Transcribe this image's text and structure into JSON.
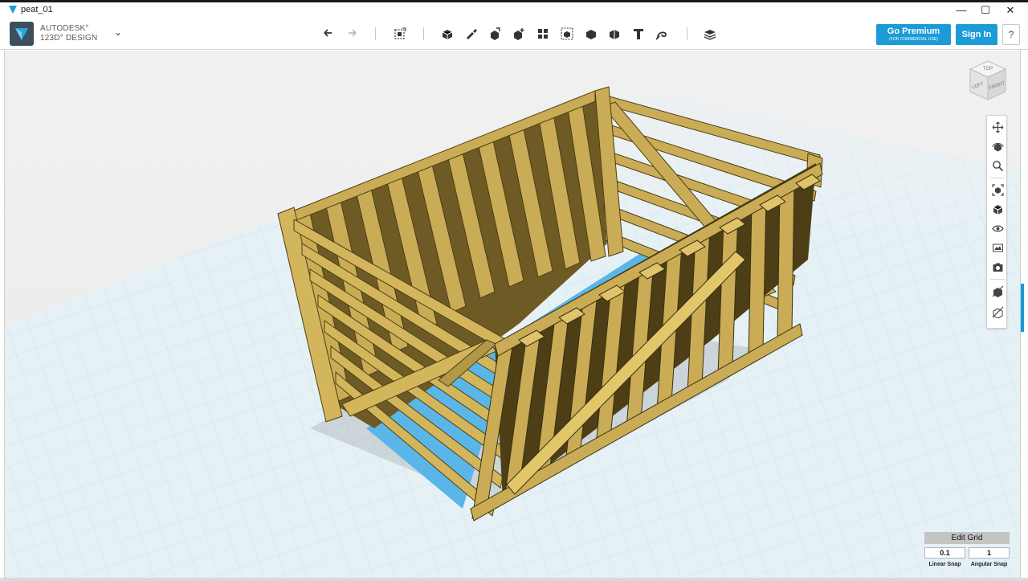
{
  "window": {
    "title": "peat_01",
    "minimize_glyph": "—",
    "maximize_glyph": "☐",
    "close_glyph": "✕"
  },
  "brand": {
    "line1": "AUTODESK°",
    "line2": "123D° DESIGN",
    "menu_caret": "⌄"
  },
  "toolbar": {
    "tools": [
      {
        "icon": "undo-icon"
      },
      {
        "icon": "redo-icon"
      },
      {
        "icon": "transform-icon"
      },
      {
        "icon": "primitives-icon"
      },
      {
        "icon": "sketch-icon"
      },
      {
        "icon": "construct-icon"
      },
      {
        "icon": "modify-icon"
      },
      {
        "icon": "pattern-icon"
      },
      {
        "icon": "grouping-icon"
      },
      {
        "icon": "combine-icon"
      },
      {
        "icon": "measure-icon"
      },
      {
        "icon": "text-icon"
      },
      {
        "icon": "snap-icon"
      },
      {
        "icon": "material-icon"
      }
    ],
    "premium_label": "Go Premium",
    "premium_sublabel": "(FOR COMMERCIAL USE)",
    "signin_label": "Sign In",
    "help_label": "?"
  },
  "viewcube": {
    "top": "TOP",
    "left": "LEFT",
    "front": "FRONT"
  },
  "nav_panel": {
    "buttons": [
      "pan-icon",
      "orbit-icon",
      "zoom-icon",
      "fit-icon",
      "view-icon",
      "visibility-icon",
      "materials-icon",
      "screenshot-icon",
      "mesh-icon",
      "solid-icon"
    ]
  },
  "grid_panel": {
    "edit_grid_label": "Edit Grid",
    "linear_snap_value": "0.1",
    "angular_snap_value": "1",
    "linear_snap_label": "Linear Snap",
    "angular_snap_label": "Angular Snap"
  },
  "colors": {
    "accent": "#1b9bd7",
    "wood": "#c9ac55",
    "wood_dark": "#6e5a25",
    "floor": "#5bb6e8",
    "grid_line": "#a9d4e8"
  }
}
